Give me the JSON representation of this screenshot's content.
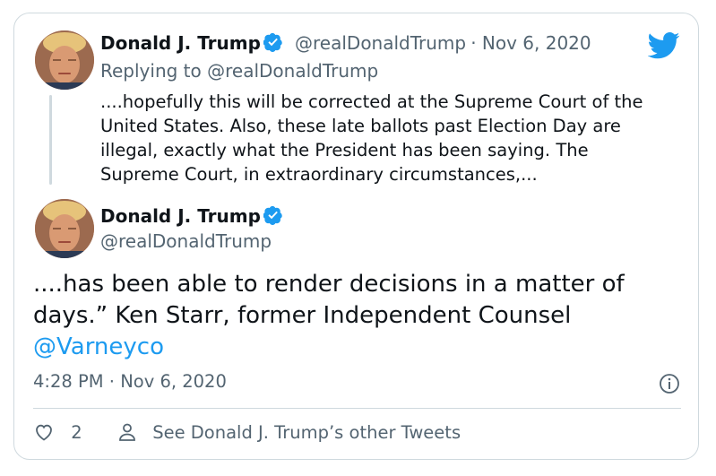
{
  "quoted_tweet": {
    "author_name": "Donald J. Trump",
    "handle": "@realDonaldTrump",
    "date": "Nov 6, 2020",
    "replying_to_prefix": "Replying to ",
    "replying_to_handle": "@realDonaldTrump",
    "text": "....hopefully this will be corrected at the Supreme Court of the United States. Also, these late ballots past Election Day are illegal, exactly what the President has been saying. The Supreme Court, in extraordinary circumstances,..."
  },
  "main_tweet": {
    "author_name": "Donald J. Trump",
    "handle": "@realDonaldTrump",
    "text": "....has been able to render decisions in a matter of days.” Ken Starr, former Independent Counsel ",
    "mention": "@Varneyco",
    "time": "4:28 PM",
    "date": "Nov 6, 2020"
  },
  "footer": {
    "like_count": "2",
    "other_tweets_label": "See Donald J. Trump’s other Tweets"
  },
  "colors": {
    "twitter_blue": "#1d9bf0",
    "secondary_text": "#536471",
    "border": "#cfd9de"
  },
  "icons": [
    "twitter-bird-icon",
    "verified-badge-icon",
    "info-icon",
    "heart-icon",
    "person-icon"
  ]
}
